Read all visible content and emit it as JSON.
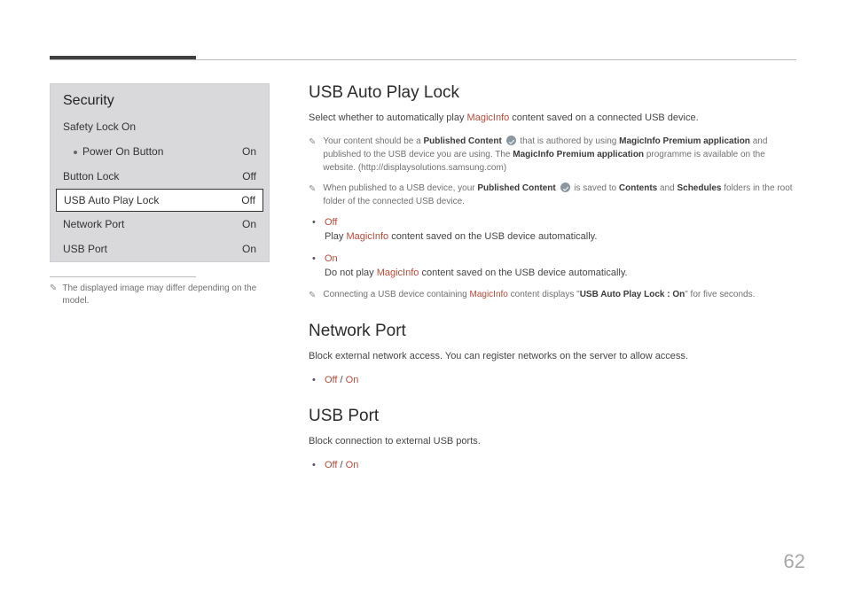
{
  "sidebar": {
    "title": "Security",
    "rows": [
      {
        "label": "Safety Lock On",
        "value": "",
        "indent": false,
        "selected": false
      },
      {
        "label": "Power On Button",
        "value": "On",
        "indent": true,
        "selected": false
      },
      {
        "label": "Button Lock",
        "value": "Off",
        "indent": false,
        "selected": false
      },
      {
        "label": "USB Auto Play Lock",
        "value": "Off",
        "indent": false,
        "selected": true
      },
      {
        "label": "Network Port",
        "value": "On",
        "indent": false,
        "selected": false
      },
      {
        "label": "USB Port",
        "value": "On",
        "indent": false,
        "selected": false
      }
    ],
    "footnote": "The displayed image may differ depending on the model."
  },
  "section1": {
    "title": "USB Auto Play Lock",
    "intro_pre": "Select whether to automatically play ",
    "intro_term": "MagicInfo",
    "intro_post": " content saved on a connected USB device.",
    "note1_a": "Your content should be a ",
    "note1_b": "Published Content",
    "note1_c": " that is authored by using ",
    "note1_d": "MagicInfo Premium application",
    "note1_e": " and published to the USB device you are using. The ",
    "note1_f": "MagicInfo Premium application",
    "note1_g": " programme is available on the website. (http://displaysolutions.samsung.com)",
    "note2_a": "When published to a USB device, your ",
    "note2_b": "Published Content",
    "note2_c": " is saved to ",
    "note2_d": "Contents",
    "note2_e": " and ",
    "note2_f": "Schedules",
    "note2_g": " folders in the root folder of the connected USB device.",
    "off_label": "Off",
    "off_a": "Play ",
    "off_term": "MagicInfo",
    "off_b": " content saved on the USB device automatically.",
    "on_label": "On",
    "on_a": "Do not play ",
    "on_term": "MagicInfo",
    "on_b": " content saved on the USB device automatically.",
    "note3_a": "Connecting a USB device containing ",
    "note3_term": "MagicInfo",
    "note3_b": " content displays \"",
    "note3_bold": "USB Auto Play Lock : On",
    "note3_c": "\" for five seconds."
  },
  "section2": {
    "title": "Network Port",
    "body": "Block external network access. You can register networks on the server to allow access.",
    "opt_off": "Off",
    "opt_sep": " / ",
    "opt_on": "On"
  },
  "section3": {
    "title": "USB Port",
    "body": "Block connection to external USB ports.",
    "opt_off": "Off",
    "opt_sep": " / ",
    "opt_on": "On"
  },
  "page_number": "62"
}
